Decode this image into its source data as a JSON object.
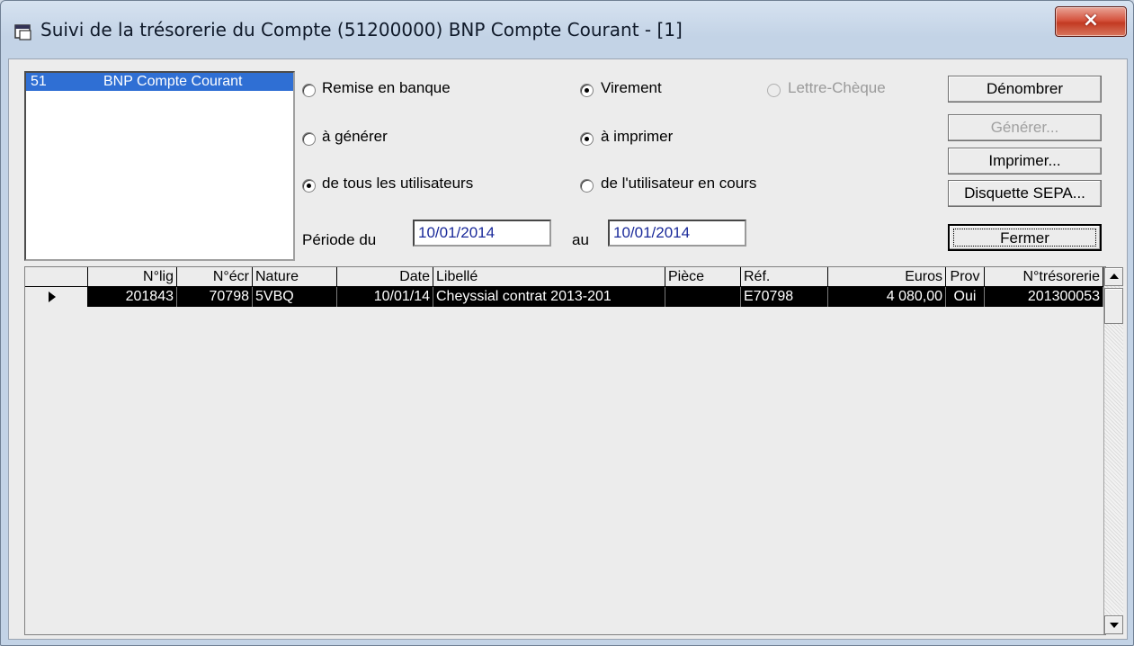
{
  "window": {
    "title": "Suivi de la trésorerie du Compte (51200000) BNP Compte Courant - [1]",
    "close_glyph": "×"
  },
  "account_list": {
    "items": [
      {
        "code": "51",
        "name": "BNP Compte Courant",
        "selected": true
      }
    ]
  },
  "options": {
    "remise_label": "Remise en banque",
    "virement_label": "Virement",
    "lettre_label": "Lettre-Chèque",
    "a_generer_label": "à générer",
    "a_imprimer_label": "à imprimer",
    "tous_label": "de tous les utilisateurs",
    "utilisateur_label": "de l'utilisateur en cours",
    "selected": [
      "Virement",
      "à imprimer",
      "de tous les utilisateurs"
    ]
  },
  "period": {
    "from_label": "Période du",
    "from_value": "10/01/2014",
    "to_label": "au",
    "to_value": "10/01/2014"
  },
  "buttons": {
    "denombrer": "Dénombrer",
    "generer": "Générer...",
    "imprimer": "Imprimer...",
    "disquette": "Disquette SEPA...",
    "fermer": "Fermer"
  },
  "grid": {
    "headers": [
      "N°lig",
      "N°écr",
      "Nature",
      "Date",
      "Libellé",
      "Pièce",
      "Réf.",
      "Euros",
      "Prov",
      "N°trésorerie"
    ],
    "rows": [
      {
        "nlig": "201843",
        "necr": "70798",
        "nature": "5VBQ",
        "date": "10/01/14",
        "libelle": "Cheyssial contrat 2013-201",
        "piece": "",
        "ref": "E70798",
        "euros": "4 080,00",
        "prov": "Oui",
        "ntreso": "201300053"
      }
    ]
  },
  "colors": {
    "selection": "#2f6fd4",
    "row_highlight": "#000000",
    "input_text": "#1a2a9a"
  }
}
